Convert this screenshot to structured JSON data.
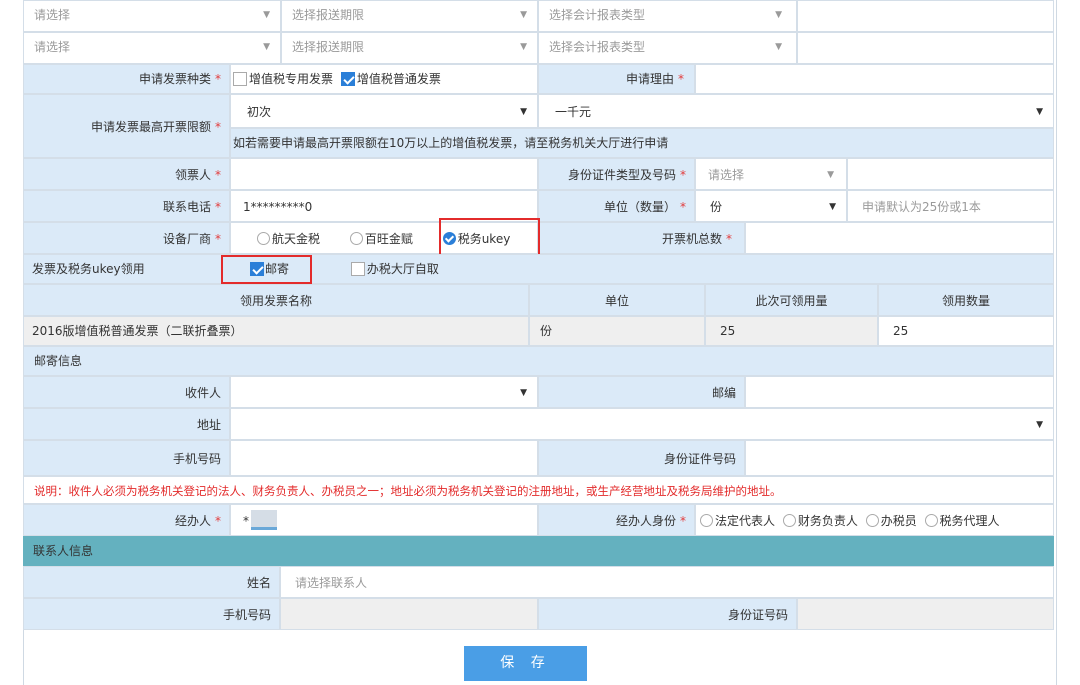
{
  "rows_top": [
    {
      "col1": "请选择",
      "col2": "选择报送期限",
      "col3": "选择会计报表类型"
    },
    {
      "col1": "请选择",
      "col2": "选择报送期限",
      "col3": "选择会计报表类型"
    }
  ],
  "invoice_type": {
    "label": "申请发票种类",
    "opt1": "增值税专用发票",
    "opt1_checked": false,
    "opt2": "增值税普通发票",
    "opt2_checked": true
  },
  "reason": {
    "label": "申请理由"
  },
  "max_limit": {
    "label": "申请发票最高开票限额",
    "select1": "初次",
    "select2": "一千元",
    "note": "如若需要申请最高开票限额在10万以上的增值税发票，请至税务机关大厅进行申请"
  },
  "receiver": {
    "label": "领票人"
  },
  "id_type": {
    "label": "身份证件类型及号码",
    "placeholder": "请选择"
  },
  "phone": {
    "label": "联系电话",
    "value": "1*********0"
  },
  "unit_qty": {
    "label": "单位（数量）",
    "value": "份",
    "hint": "申请默认为25份或1本"
  },
  "vendor": {
    "label": "设备厂商",
    "opt1": "航天金税",
    "opt2": "百旺金赋",
    "opt3": "税务ukey",
    "selected": "税务ukey"
  },
  "machine_total": {
    "label": "开票机总数"
  },
  "pickup": {
    "label": "发票及税务ukey领用",
    "opt1": "邮寄",
    "opt1_checked": true,
    "opt2": "办税大厅自取",
    "opt2_checked": false
  },
  "table": {
    "headers": [
      "领用发票名称",
      "单位",
      "此次可领用量",
      "领用数量"
    ],
    "row": {
      "name": "2016版增值税普通发票（二联折叠票）",
      "unit": "份",
      "available": "25",
      "qty": "25"
    }
  },
  "mail": {
    "title": "邮寄信息",
    "recipient_label": "收件人",
    "zip_label": "邮编",
    "address_label": "地址",
    "mobile_label": "手机号码",
    "id_label": "身份证件号码",
    "note": "说明：收件人必须为税务机关登记的法人、财务负责人、办税员之一；地址必须为税务机关登记的注册地址，或生产经营地址及税务局维护的地址。"
  },
  "handler": {
    "label": "经办人",
    "value": "*",
    "role_label": "经办人身份",
    "roles": [
      "法定代表人",
      "财务负责人",
      "办税员",
      "税务代理人"
    ]
  },
  "contact": {
    "title": "联系人信息",
    "name_label": "姓名",
    "name_placeholder": "请选择联系人",
    "mobile_label": "手机号码",
    "id_label": "身份证号码"
  },
  "save_label": "保 存",
  "star": "*",
  "accent": "#2b7fd8",
  "highlight": "#e32b2b"
}
